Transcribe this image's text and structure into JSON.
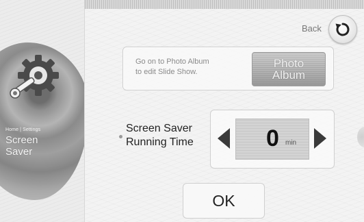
{
  "left_panel": {
    "breadcrumb": "Home | Settings",
    "title_line1": "Screen",
    "title_line2": "Saver",
    "icon": "gear-wrench-icon"
  },
  "header": {
    "back_label": "Back",
    "back_icon": "refresh-back-icon"
  },
  "photo_album": {
    "hint_line1": "Go on to Photo Album",
    "hint_line2": "to edit Slide Show.",
    "button_line1": "Photo",
    "button_line2": "Album"
  },
  "screen_saver": {
    "label_line1": "Screen Saver",
    "label_line2": "Running Time",
    "value": "0",
    "unit": "min",
    "decrease_icon": "triangle-left-icon",
    "increase_icon": "triangle-right-icon"
  },
  "footer": {
    "ok_label": "OK"
  }
}
